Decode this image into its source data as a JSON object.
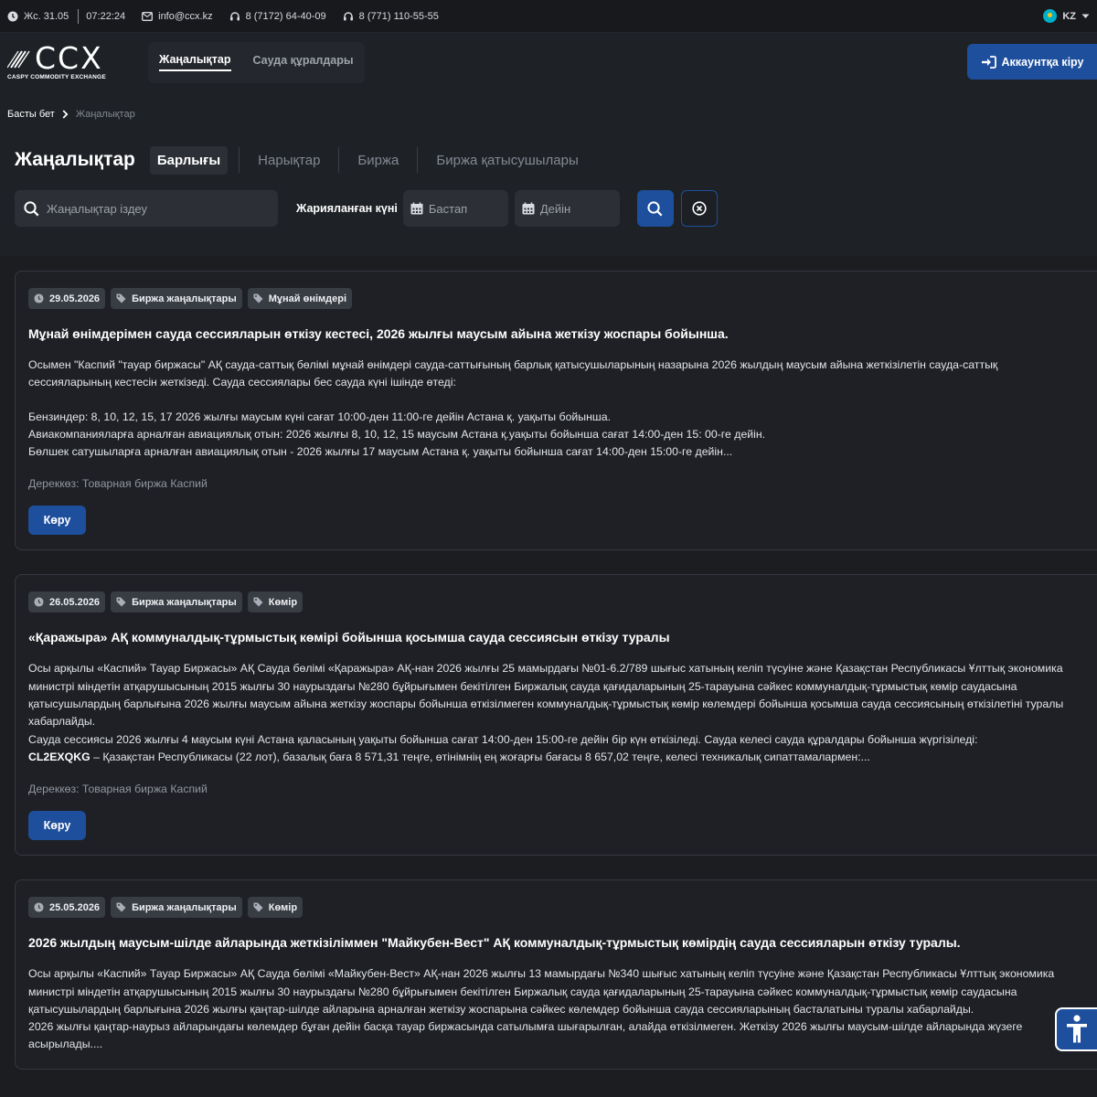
{
  "topbar": {
    "date": "Жс. 31.05",
    "time": "07:22:24",
    "email": "info@ccx.kz",
    "phone1": "8 (7172) 64-40-09",
    "phone2": "8 (771) 110-55-55",
    "language": "KZ"
  },
  "header": {
    "logo_text": "CCX",
    "logo_subtitle": "CASPY COMMODITY EXCHANGE",
    "nav": [
      {
        "label": "Жаңалықтар",
        "active": true
      },
      {
        "label": "Сауда құралдары",
        "active": false
      }
    ],
    "login_label": "Аккаунтқа кіру"
  },
  "breadcrumb": {
    "home": "Басты бет",
    "current": "Жаңалықтар"
  },
  "filters": {
    "title": "Жаңалықтар",
    "tabs": [
      "Барлығы",
      "Нарықтар",
      "Биржа",
      "Биржа қатысушылары"
    ],
    "active_tab": "Барлығы",
    "search_placeholder": "Жаңалықтар іздеу",
    "date_label": "Жарияланған күні",
    "date_from_placeholder": "Бастап",
    "date_to_placeholder": "Дейін"
  },
  "news": [
    {
      "date": "29.05.2026",
      "tags": [
        "Биржа жаңалықтары",
        "Мұнай өнімдері"
      ],
      "title": "Мұнай өнімдерімен сауда сессияларын өткізу кестесі, 2026 жылғы маусым айына жеткізу жоспары бойынша.",
      "paragraphs": [
        "Осымен \"Каспий \"тауар биржасы\" АҚ сауда-саттық бөлімі мұнай өнімдері сауда-саттығының барлық қатысушыларының назарына 2026 жылдың маусым айына жеткізілетін сауда-саттық сессияларының кестесін жеткізеді. Сауда сессиялары бес сауда күні ішінде өтеді:",
        "Бензиндер: 8, 10, 12, 15, 17 2026 жылғы маусым күні сағат 10:00-ден 11:00-ге дейін Астана қ. уақыты бойынша.",
        "Авиакомпанияларға арналған авиациялық отын: 2026 жылғы 8, 10, 12, 15 маусым Астана қ.уақыты бойынша сағат 14:00-ден 15: 00-ге дейін.",
        "Бөлшек сатушыларға арналған авиациялық отын - 2026 жылғы 17 маусым Астана қ. уақыты бойынша сағат 14:00-ден 15:00-ге дейін..."
      ],
      "source": "Дереккөз: Товарная биржа Каспий",
      "button": "Көру"
    },
    {
      "date": "26.05.2026",
      "tags": [
        "Биржа жаңалықтары",
        "Көмір"
      ],
      "title": "«Қаражыра» АҚ коммуналдық-тұрмыстық көмірі бойынша қосымша сауда сессиясын өткізу туралы",
      "paragraphs": [
        "Осы арқылы «Каспий» Тауар Биржасы» АҚ Сауда бөлімі «Қаражыра» АҚ-нан 2026 жылғы 25 мамырдағы №01-6.2/789 шығыс хатының келіп түсуіне және Қазақстан Республикасы Ұлттық экономика министрі міндетін атқарушысының 2015 жылғы 30 наурыздағы №280 бұйрығымен бекітілген Биржалық сауда қағидаларының 25-тарауына сәйкес коммуналдық-тұрмыстық көмір саудасына қатысушылардың барлығына 2026 жылғы маусым айына жеткізу жоспары бойынша өткізілмеген коммуналдық-тұрмыстық көмір көлемдері бойынша қосымша сауда сессиясының өткізілетіні туралы хабарлайды.",
        "Сауда сессиясы 2026 жылғы 4 маусым күні Астана қаласының уақыты бойынша сағат 14:00-ден 15:00-ге дейін бір күн өткізіледі. Сауда келесі сауда құралдары бойынша жүргізіледі:"
      ],
      "code": "CL2EXQKG",
      "code_text": " – Қазақстан Республикасы (22 лот), базалық баға 8 571,31 теңге, өтінімнің ең жоғарғы бағасы 8 657,02 теңге, келесі техникалық сипаттамалармен:...",
      "source": "Дереккөз: Товарная биржа Каспий",
      "button": "Көру"
    },
    {
      "date": "25.05.2026",
      "tags": [
        "Биржа жаңалықтары",
        "Көмір"
      ],
      "title": "2026 жылдың маусым-шілде айларында жеткізіліммен \"Майкубен-Вест\" АҚ коммуналдық-тұрмыстық көмірдің сауда сессияларын өткізу туралы.",
      "paragraphs": [
        "Осы арқылы «Каспий» Тауар Биржасы» АҚ Сауда бөлімі «Майкубен-Вест» АҚ-нан 2026 жылғы 13 мамырдағы №340 шығыс хатының келіп түсуіне және Қазақстан Республикасы Ұлттық экономика министрі міндетін атқарушысының 2015 жылғы 30 наурыздағы №280 бұйрығымен бекітілген Биржалық сауда қағидаларының 25-тарауына сәйкес коммуналдық-тұрмыстық көмір саудасына қатысушылардың барлығына 2026 жылғы қаңтар-шілде айларына арналған жеткізу жоспарына сәйкес көлемдер бойынша сауда сессияларының басталатыны туралы хабарлайды.",
        "2026 жылғы қаңтар-наурыз айларындағы көлемдер бұған дейін басқа тауар биржасында сатылымға шығарылған, алайда өткізілмеген. Жеткізу 2026 жылғы маусым-шілде айларында жүзеге асырылады...."
      ]
    }
  ]
}
